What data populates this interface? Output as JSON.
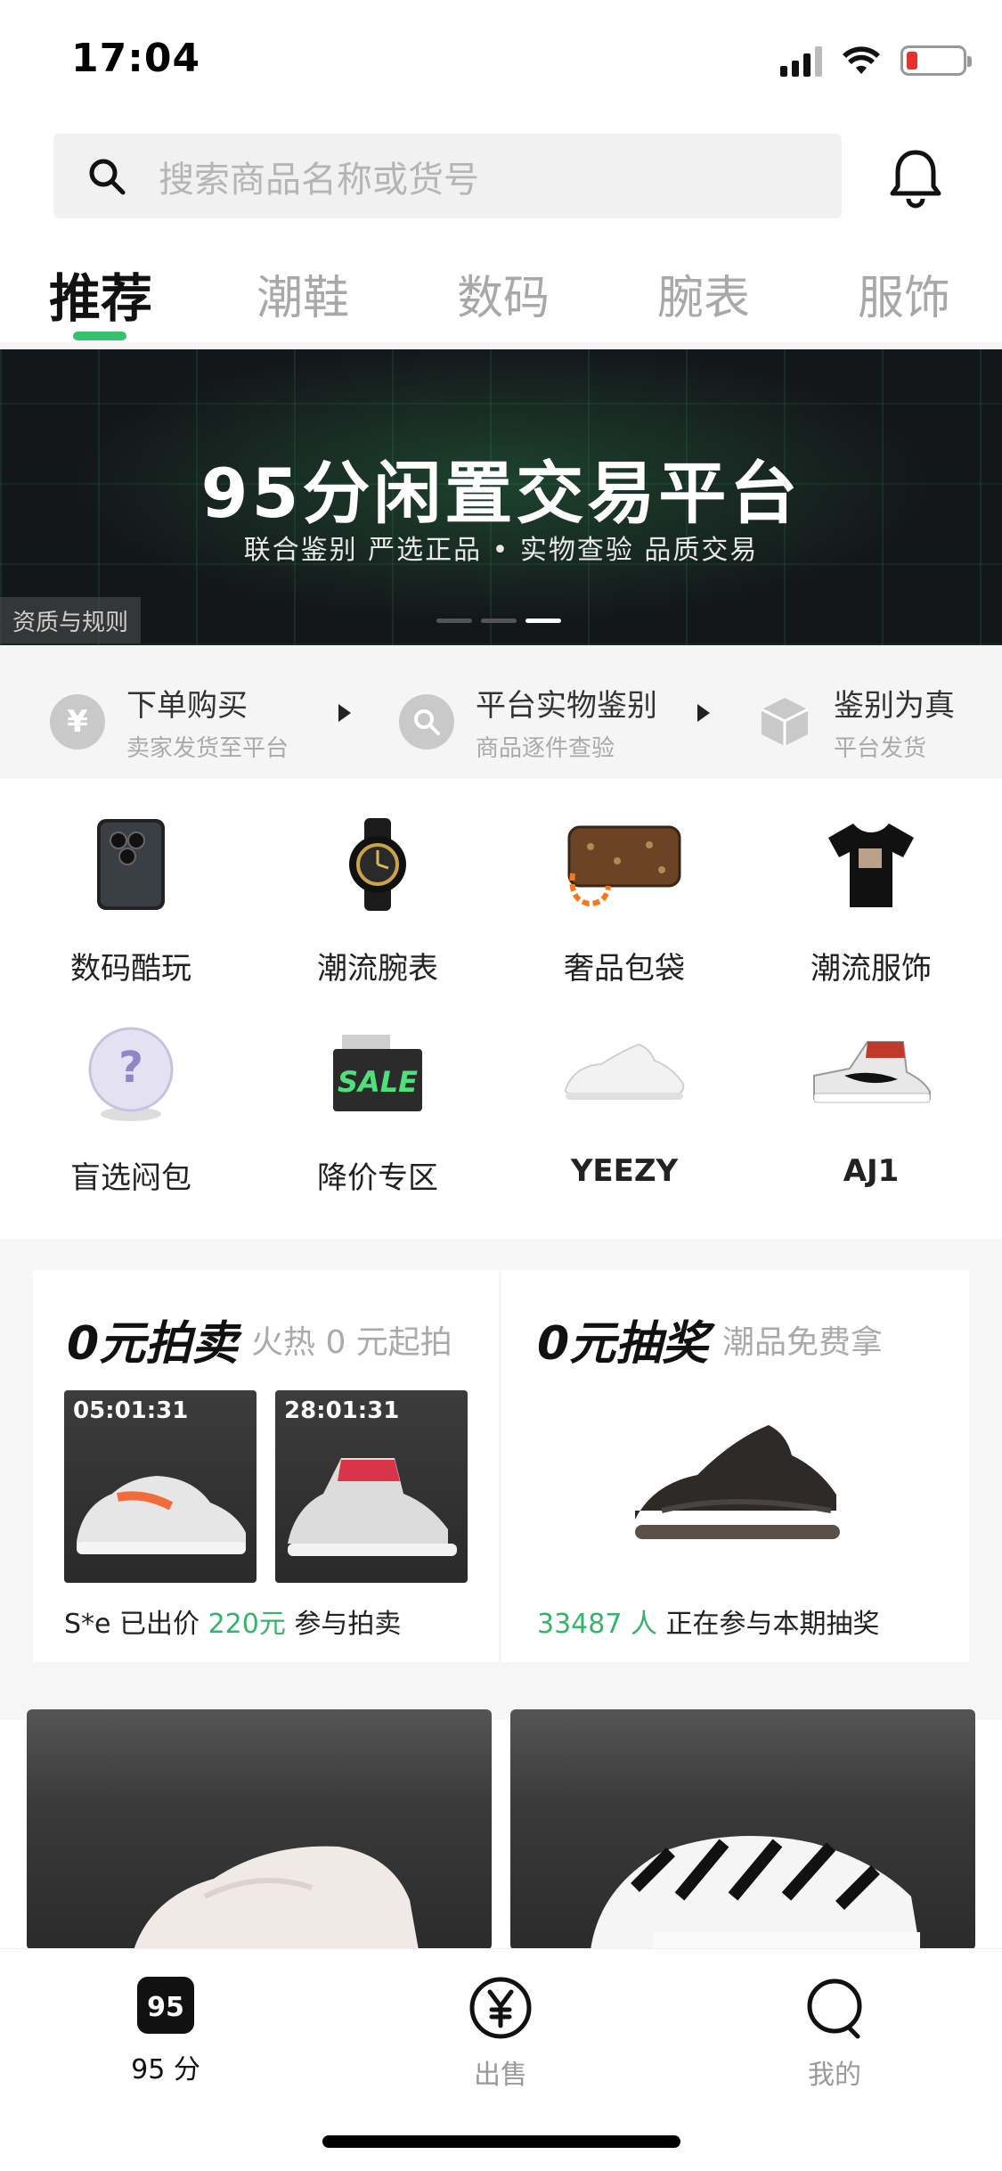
{
  "status_bar": {
    "time": "17:04"
  },
  "search": {
    "placeholder": "搜索商品名称或货号"
  },
  "tabs": [
    {
      "label": "推荐",
      "active": true
    },
    {
      "label": "潮鞋",
      "active": false
    },
    {
      "label": "数码",
      "active": false
    },
    {
      "label": "腕表",
      "active": false
    },
    {
      "label": "服饰",
      "active": false
    }
  ],
  "banner": {
    "title": "95分闲置交易平台",
    "subtitle": "联合鉴别 严选正品 • 实物查验 品质交易",
    "rules_label": "资质与规则",
    "page_count": 3,
    "active_page": 3
  },
  "process": [
    {
      "title": "下单购买",
      "subtitle": "卖家发货至平台",
      "icon": "yen-icon"
    },
    {
      "title": "平台实物鉴别",
      "subtitle": "商品逐件查验",
      "icon": "search-icon"
    },
    {
      "title": "鉴别为真",
      "subtitle": "平台发货",
      "icon": "box-icon"
    }
  ],
  "categories": [
    {
      "label": "数码酷玩",
      "icon": "phone-icon"
    },
    {
      "label": "潮流腕表",
      "icon": "watch-icon"
    },
    {
      "label": "奢品包袋",
      "icon": "bag-icon"
    },
    {
      "label": "潮流服饰",
      "icon": "tshirt-icon"
    },
    {
      "label": "盲选闷包",
      "icon": "mystery-ball-icon"
    },
    {
      "label": "降价专区",
      "icon": "sale-coupon-icon"
    },
    {
      "label": "YEEZY",
      "icon": "yeezy-sneaker-icon"
    },
    {
      "label": "AJ1",
      "icon": "aj1-sneaker-icon"
    }
  ],
  "auction": {
    "title": "0元拍卖",
    "subtitle": "火热 0 元起拍",
    "items": [
      {
        "timer": "05:01:31"
      },
      {
        "timer": "28:01:31"
      }
    ],
    "footer_user": "S*e 已出价",
    "footer_price": "220元",
    "footer_suffix": "参与拍卖"
  },
  "lottery": {
    "title": "0元抽奖",
    "subtitle": "潮品免费拿",
    "footer_count": "33487 人",
    "footer_suffix": "正在参与本期抽奖"
  },
  "tabbar": [
    {
      "label": "95 分",
      "icon": "95-logo-icon",
      "active": true
    },
    {
      "label": "出售",
      "icon": "yen-circle-icon",
      "active": false
    },
    {
      "label": "我的",
      "icon": "profile-icon",
      "active": false
    }
  ],
  "colors": {
    "accent": "#36c16e",
    "banner_bg": "#14171a",
    "text_muted": "#a8a8a8"
  }
}
